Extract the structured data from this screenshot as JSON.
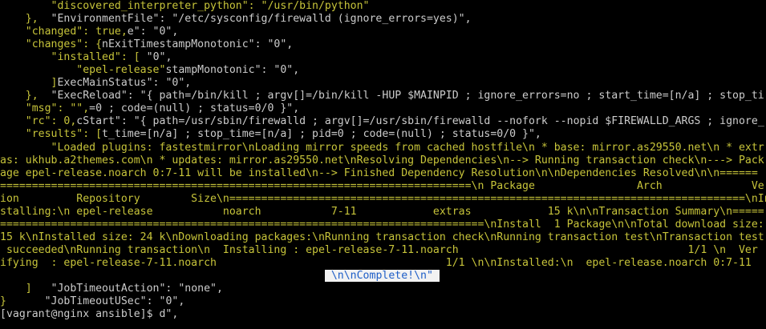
{
  "window": {
    "title": "vagrant@nginx ansible"
  },
  "colors": {
    "background": "#000000",
    "yellow_text": "#c7c43a",
    "white_text": "#cccccc",
    "selection_bg": "#f2f2f2",
    "selection_fg": "#1e5ec8"
  },
  "lines": [
    [
      {
        "c": "yellow",
        "t": "        \"discovered_interpreter_python\": \"/usr/bin/python\""
      }
    ],
    [
      {
        "c": "yellow",
        "t": "    },"
      },
      {
        "c": "white",
        "t": "  \"EnvironmentFile\": \"/etc/sysconfig/firewalld (ignore_errors=yes)\","
      }
    ],
    [
      {
        "c": "yellow",
        "t": "    \"changed\": true,"
      },
      {
        "c": "white",
        "t": "e\": \"0\","
      }
    ],
    [
      {
        "c": "yellow",
        "t": "    \"changes\": {"
      },
      {
        "c": "white",
        "t": "nExitTimestampMonotonic\": \"0\","
      }
    ],
    [
      {
        "c": "yellow",
        "t": "        \"installed\": [ "
      },
      {
        "c": "white",
        "t": "\"0\","
      }
    ],
    [
      {
        "c": "yellow",
        "t": "            \"epel-release\""
      },
      {
        "c": "white",
        "t": "stampMonotonic\": \"0\","
      }
    ],
    [
      {
        "c": "yellow",
        "t": "        ]"
      },
      {
        "c": "white",
        "t": "ExecMainStatus\": \"0\","
      }
    ],
    [
      {
        "c": "yellow",
        "t": "    },"
      },
      {
        "c": "white",
        "t": "  \"ExecReload\": \"{ path=/bin/kill ; argv[]=/bin/kill -HUP $MAINPID ; ignore_errors=no ; start_time=[n/a] ; stop_ti"
      }
    ],
    [
      {
        "c": "yellow",
        "t": "    \"msg\": \"\","
      },
      {
        "c": "white",
        "t": "=0 ; code=(null) ; status=0/0 }\","
      }
    ],
    [
      {
        "c": "yellow",
        "t": "    \"rc\": 0,"
      },
      {
        "c": "white",
        "t": "cStart\": \"{ path=/usr/sbin/firewalld ; argv[]=/usr/sbin/firewalld --nofork --nopid $FIREWALLD_ARGS ; ignore_"
      }
    ],
    [
      {
        "c": "yellow",
        "t": "    \"results\": ["
      },
      {
        "c": "white",
        "t": "t_time=[n/a] ; stop_time=[n/a] ; pid=0 ; code=(null) ; status=0/0 }\","
      }
    ],
    [
      {
        "c": "yellow",
        "t": "        \"Loaded plugins: fastestmirror\\nLoading mirror speeds from cached hostfile\\n * base: mirror.as29550.net\\n * extr"
      }
    ],
    [
      {
        "c": "yellow",
        "t": "as: ukhub.a2themes.com\\n * updates: mirror.as29550.net\\nResolving Dependencies\\n--> Running transaction check\\n---> Pack"
      }
    ],
    [
      {
        "c": "yellow",
        "t": "age epel-release.noarch 0:7-11 will be installed\\n--> Finished Dependency Resolution\\n\\nDependencies Resolved\\n\\n======"
      }
    ],
    [
      {
        "c": "yellow",
        "t": "==========================================================================\\n Package                Arch              Vers"
      }
    ],
    [
      {
        "c": "yellow",
        "t": "ion         Repository        Size\\n=================================================================================\\nIn"
      }
    ],
    [
      {
        "c": "yellow",
        "t": "stalling:\\n epel-release           noarch           7-11            extras            15 k\\n\\nTransaction Summary\\n====="
      }
    ],
    [
      {
        "c": "yellow",
        "t": "============================================================================\\nInstall  1 Package\\n\\nTotal download size:"
      }
    ],
    [
      {
        "c": "yellow",
        "t": "15 k\\nInstalled size: 24 k\\nDownloading packages:\\nRunning transaction check\\nRunning transaction test\\nTransaction test"
      }
    ],
    [
      {
        "c": "yellow",
        "t": " succeeded\\nRunning transaction\\n  Installing : epel-release-7-11.noarch                                    1/1 \\n  Ver"
      }
    ],
    [
      {
        "c": "yellow",
        "t": "ifying  : epel-release-7-11.noarch                                    1/1 \\n\\nInstalled:\\n  epel-release.noarch 0:7-11"
      }
    ],
    [
      {
        "c": "yellow",
        "t": "                                                   "
      },
      {
        "c": "sel",
        "t": " \\n\\nComplete!\\n\" "
      }
    ],
    [
      {
        "c": "yellow",
        "t": "    ]"
      },
      {
        "c": "white",
        "t": "   \"JobTimeoutAction\": \"none\","
      }
    ],
    [
      {
        "c": "yellow",
        "t": "}"
      },
      {
        "c": "white",
        "t": "      \"JobTimeoutUSec\": \"0\","
      }
    ],
    [
      {
        "c": "white",
        "t": "[vagrant@nginx ansible]$ d\","
      }
    ]
  ]
}
